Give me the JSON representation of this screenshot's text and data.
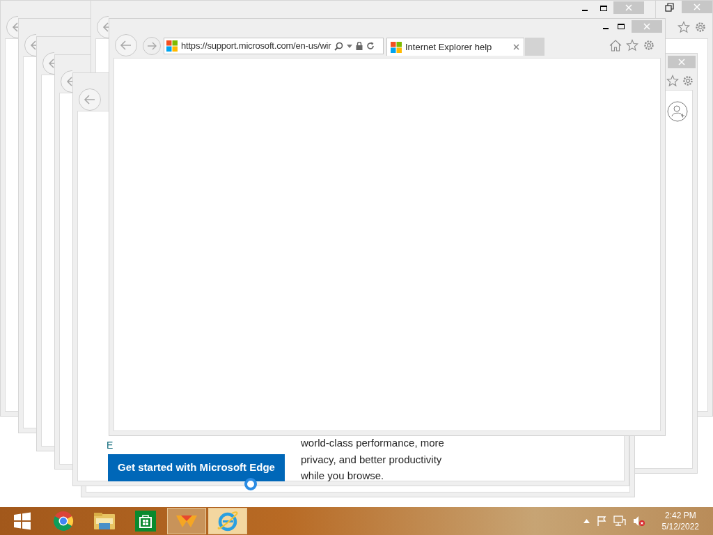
{
  "browser": {
    "address": "https://support.microsoft.com/en-us/wir",
    "tab": {
      "title": "Internet Explorer help",
      "selected": true
    }
  },
  "page_behind": {
    "link_fragment": "E",
    "button": "Get started with Microsoft Edge",
    "blurb": "world-class performance, more privacy, and better productivity while you browse."
  },
  "taskbar": {
    "apps": [
      {
        "kind": "start",
        "running": false,
        "selected": false
      },
      {
        "kind": "chrome",
        "running": false,
        "selected": false
      },
      {
        "kind": "explorer",
        "running": false,
        "selected": false
      },
      {
        "kind": "store",
        "running": false,
        "selected": false
      },
      {
        "kind": "wps",
        "running": true,
        "selected": false
      },
      {
        "kind": "ie",
        "running": true,
        "selected": true
      }
    ],
    "clock": {
      "time": "2:42 PM",
      "date": "5/12/2022"
    }
  }
}
